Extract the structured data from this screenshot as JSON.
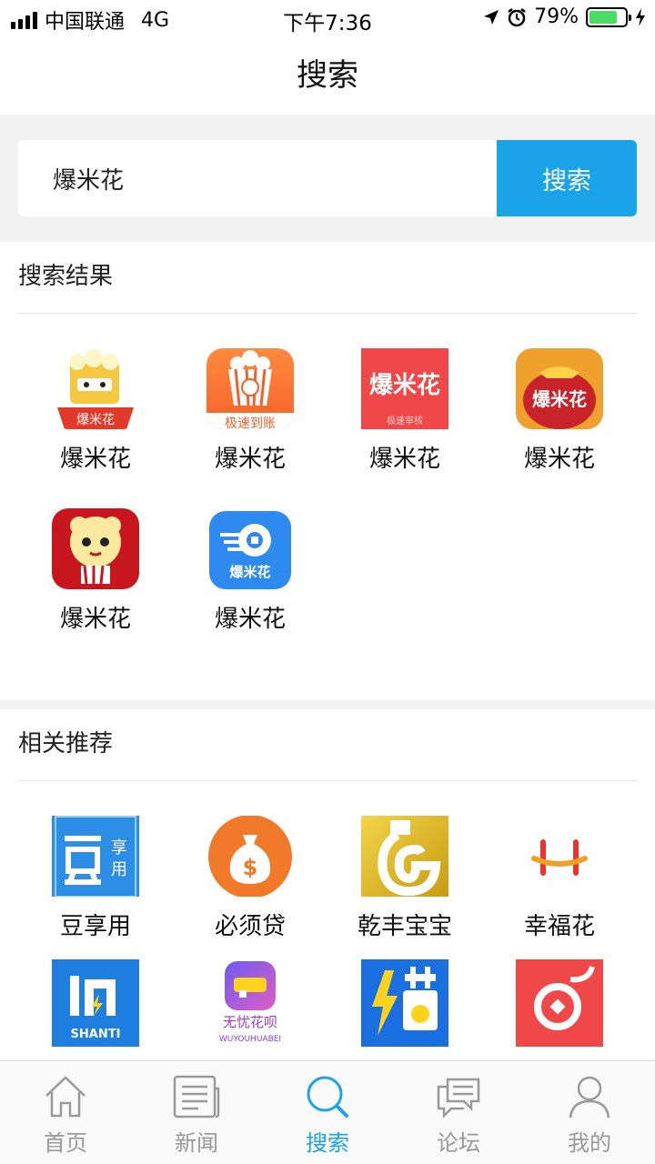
{
  "status": {
    "carrier": "中国联通",
    "network": "4G",
    "time": "下午7:36",
    "battery": "79%",
    "battery_level": 0.79
  },
  "nav": {
    "title": "搜索"
  },
  "search": {
    "value": "爆米花",
    "button_label": "搜索"
  },
  "results": {
    "title": "搜索结果",
    "items": [
      {
        "name": "爆米花",
        "icon": "popcorn-bucket-icon"
      },
      {
        "name": "爆米花",
        "icon": "popcorn-box-orange-icon"
      },
      {
        "name": "爆米花",
        "icon": "popcorn-red-text-icon"
      },
      {
        "name": "爆米花",
        "icon": "popcorn-money-bag-icon"
      },
      {
        "name": "爆米花",
        "icon": "popcorn-mascot-icon"
      },
      {
        "name": "爆米花",
        "icon": "popcorn-blue-coin-icon"
      }
    ]
  },
  "recommend": {
    "title": "相关推荐",
    "items": [
      {
        "name": "豆享用",
        "icon": "douxiangyong-icon"
      },
      {
        "name": "必须贷",
        "icon": "money-bag-dollar-icon"
      },
      {
        "name": "乾丰宝宝",
        "icon": "gold-g-icon"
      },
      {
        "name": "幸福花",
        "icon": "xingfuhua-icon"
      },
      {
        "name": "",
        "icon": "shanti-icon"
      },
      {
        "name": "",
        "icon": "wuyouhuabei-icon"
      },
      {
        "name": "",
        "icon": "jie-bolt-icon"
      },
      {
        "name": "",
        "icon": "red-coin-icon"
      }
    ]
  },
  "tabs": [
    {
      "label": "首页",
      "icon": "home-icon"
    },
    {
      "label": "新闻",
      "icon": "newspaper-icon"
    },
    {
      "label": "搜索",
      "icon": "search-icon",
      "active": true
    },
    {
      "label": "论坛",
      "icon": "chat-icon"
    },
    {
      "label": "我的",
      "icon": "user-icon"
    }
  ],
  "colors": {
    "accent": "#1ba3e8",
    "battery": "#4cd964"
  }
}
